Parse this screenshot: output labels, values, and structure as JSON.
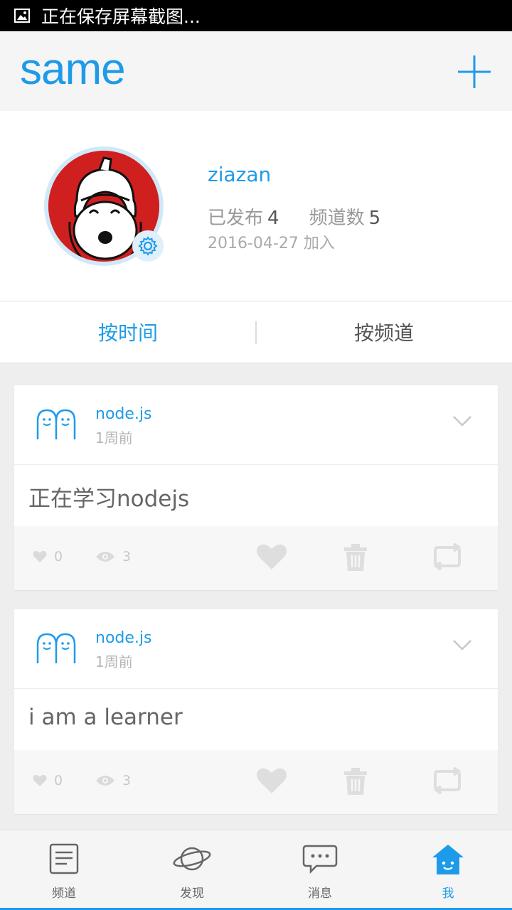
{
  "status_bar": {
    "text": "正在保存屏幕截图..."
  },
  "header": {
    "logo": "same",
    "add_icon": "plus-icon"
  },
  "profile": {
    "username": "ziazan",
    "published_label": "已发布",
    "published_count": "4",
    "channels_label": "频道数",
    "channels_count": "5",
    "joined": "2016-04-27 加入"
  },
  "tabs": [
    {
      "label": "按时间",
      "active": true
    },
    {
      "label": "按频道",
      "active": false
    }
  ],
  "posts": [
    {
      "channel": "node.js",
      "time": "1周前",
      "text": "正在学习nodejs",
      "likes": "0",
      "views": "3"
    },
    {
      "channel": "node.js",
      "time": "1周前",
      "text": "i am a learner",
      "likes": "0",
      "views": "3"
    }
  ],
  "bottom_nav": [
    {
      "label": "频道",
      "icon": "channel-list-icon"
    },
    {
      "label": "发现",
      "icon": "planet-icon"
    },
    {
      "label": "消息",
      "icon": "chat-bubble-icon"
    },
    {
      "label": "我",
      "icon": "home-face-icon",
      "active": true
    }
  ],
  "colors": {
    "accent": "#1e9be8",
    "avatar_bg": "#d01f1f"
  }
}
